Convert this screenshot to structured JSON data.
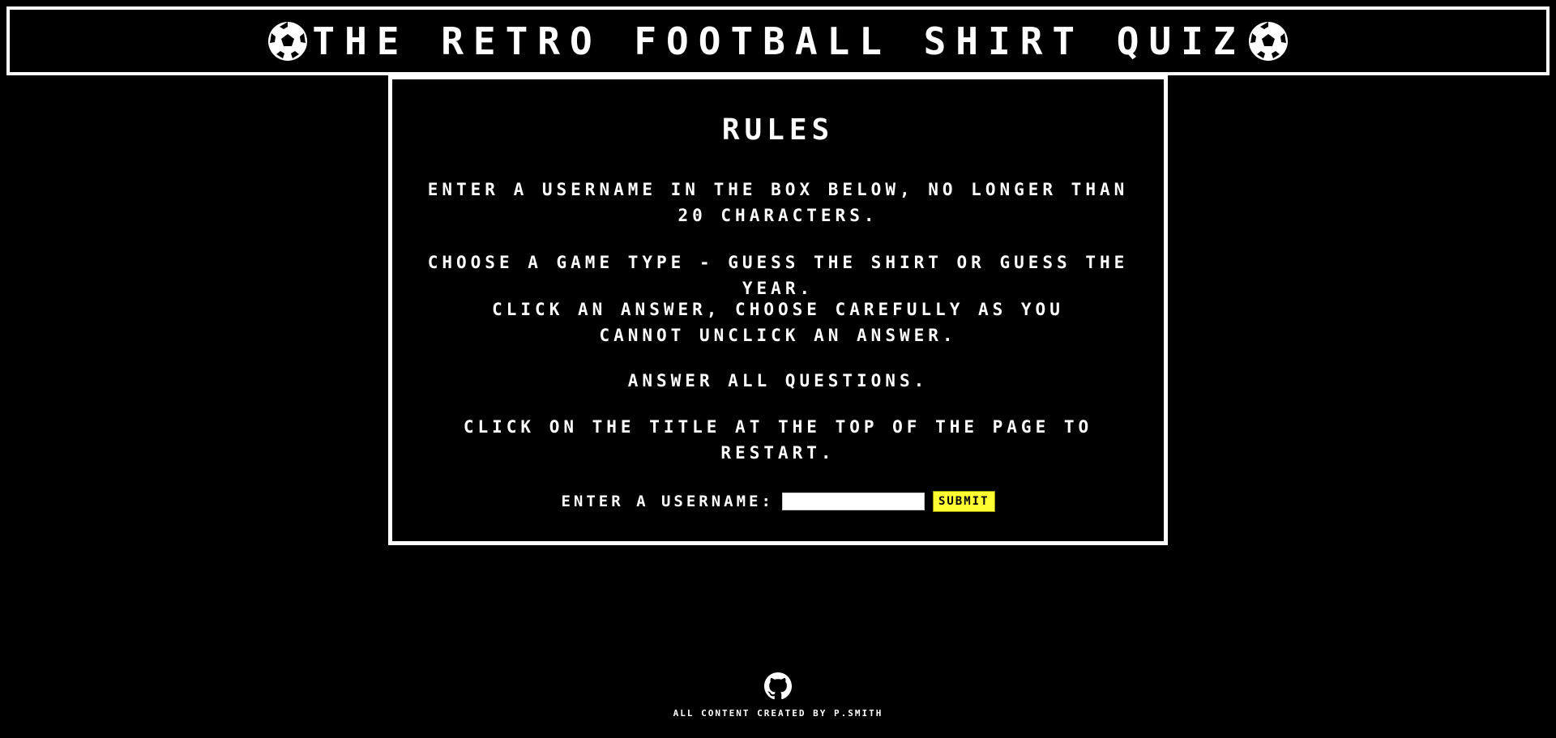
{
  "header": {
    "title": "The Retro Football Shirt Quiz",
    "left_icon": "football-icon",
    "right_icon": "football-icon"
  },
  "rules": {
    "heading": "Rules",
    "items": [
      "Enter a username in the box below, no longer than 20 characters.",
      "Choose a game type - Guess the shirt or Guess the year.",
      "Click an answer, choose carefully as you cannot unclick an answer.",
      "Answer all questions.",
      "Click on the title at the top of the page to restart."
    ]
  },
  "form": {
    "label": "Enter a username:",
    "input_value": "",
    "submit_label": "Submit"
  },
  "footer": {
    "icon": "github-icon",
    "credit": "All content created by P.Smith"
  },
  "colors": {
    "background": "#000000",
    "foreground": "#ffffff",
    "button": "#ffff33"
  }
}
